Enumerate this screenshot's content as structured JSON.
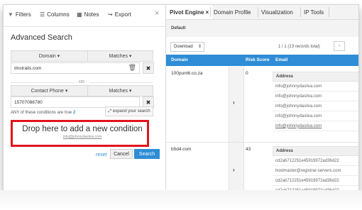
{
  "left_panel": {
    "tabs": [
      {
        "label": "Filters",
        "icon": "filter-icon"
      },
      {
        "label": "Columns",
        "icon": "columns-icon"
      },
      {
        "label": "Notes",
        "icon": "notes-icon"
      },
      {
        "label": "Export",
        "icon": "export-icon"
      }
    ],
    "close_glyph": "×",
    "title": "Advanced Search",
    "condition1": {
      "field_label": "Domain ▾",
      "match_label": "Matches ▾",
      "value": "dnstrails.com"
    },
    "or_label": "- OR -",
    "condition2": {
      "field_label": "Contact Phone ▾",
      "match_label": "Matches ▾",
      "value": "15707088780"
    },
    "any_text_prefix": "ANY of these conditions are true",
    "any_text_count": "2",
    "expand_label": "⤢ expand your search",
    "drop_zone_text": "Drop here to add a new condition",
    "drop_zone_sub": "info@johnnydasilva.com",
    "reset_label": "reset",
    "cancel_label": "Cancel",
    "search_label": "Search"
  },
  "right_panel": {
    "tabs": [
      {
        "label": "Pivot Engine",
        "active": true,
        "closable": true
      },
      {
        "label": "Domain Profile",
        "active": false
      },
      {
        "label": "Visualization",
        "active": false
      },
      {
        "label": "IP Tools",
        "active": false
      }
    ],
    "tab_close_glyph": "×",
    "view_label": "Default",
    "download_label": "Download",
    "pager_text_main": "1 / 1",
    "pager_text_sub": "(13 records total)",
    "pager_prev": "‹",
    "columns": [
      "Domain",
      "Risk Score",
      "Email"
    ],
    "rows": [
      {
        "domain": "100punt6.co.za",
        "risk_score": "0",
        "email_header": "Address",
        "emails": [
          "info@johnnydasilva.com",
          "info@johnnydasilva.com",
          "info@johnnydasilva.com",
          "info@johnnydasilva.com",
          "info@johnnydasilva.com"
        ]
      },
      {
        "domain": "b5d4.com",
        "risk_score": "43",
        "email_header": "Address",
        "emails": [
          "cd2ab712251e45919972ad36d22",
          "hostmaster@registrar-servers.com",
          "cd2ab712251e45919972ad36d22",
          "cd2ab712251e45919972ad36d22"
        ]
      }
    ]
  },
  "colors": {
    "accent_blue": "#2e8dd6",
    "highlight_red": "#e0141c"
  }
}
